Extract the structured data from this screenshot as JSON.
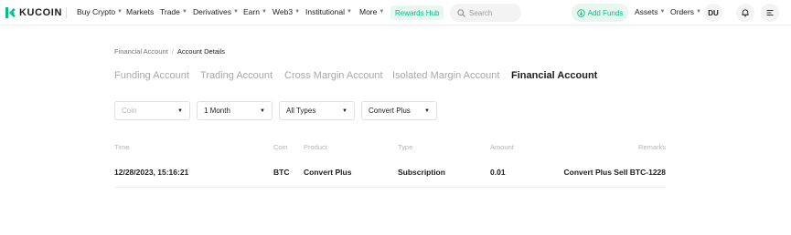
{
  "nav": {
    "logo_text": "KUCOIN",
    "items": [
      {
        "label": "Buy Crypto",
        "caret": true
      },
      {
        "label": "Markets",
        "caret": false
      },
      {
        "label": "Trade",
        "caret": true
      },
      {
        "label": "Derivatives",
        "caret": true
      },
      {
        "label": "Earn",
        "caret": true
      },
      {
        "label": "Web3",
        "caret": true
      },
      {
        "label": "Institutional",
        "caret": true
      },
      {
        "label": "More",
        "caret": true
      }
    ],
    "rewards_label": "Rewards Hub",
    "search_placeholder": "Search",
    "add_funds_label": "Add Funds",
    "assets_label": "Assets",
    "orders_label": "Orders",
    "avatar_initials": "DU",
    "accent_color": "#01bc8d"
  },
  "breadcrumb": {
    "parent": "Financial Account",
    "separator": "/",
    "current": "Account Details"
  },
  "tabs": [
    {
      "label": "Funding Account",
      "active": false
    },
    {
      "label": "Trading Account",
      "active": false
    },
    {
      "label": "Cross Margin Account",
      "active": false
    },
    {
      "label": "Isolated Margin Account",
      "active": false
    },
    {
      "label": "Financial Account",
      "active": true
    }
  ],
  "filters": {
    "coin": {
      "placeholder": "Coin",
      "value": ""
    },
    "period": {
      "value": "1 Month"
    },
    "type": {
      "value": "All Types"
    },
    "product": {
      "value": "Convert Plus"
    }
  },
  "table": {
    "columns": {
      "time": "Time",
      "coin": "Coin",
      "product": "Product",
      "type": "Type",
      "amount": "Amount",
      "remarks": "Remarks"
    },
    "rows": [
      {
        "time": "12/28/2023, 15:16:21",
        "coin": "BTC",
        "product": "Convert Plus",
        "type": "Subscription",
        "amount": "0.01",
        "remarks": "Convert Plus Sell BTC-1228"
      }
    ]
  }
}
